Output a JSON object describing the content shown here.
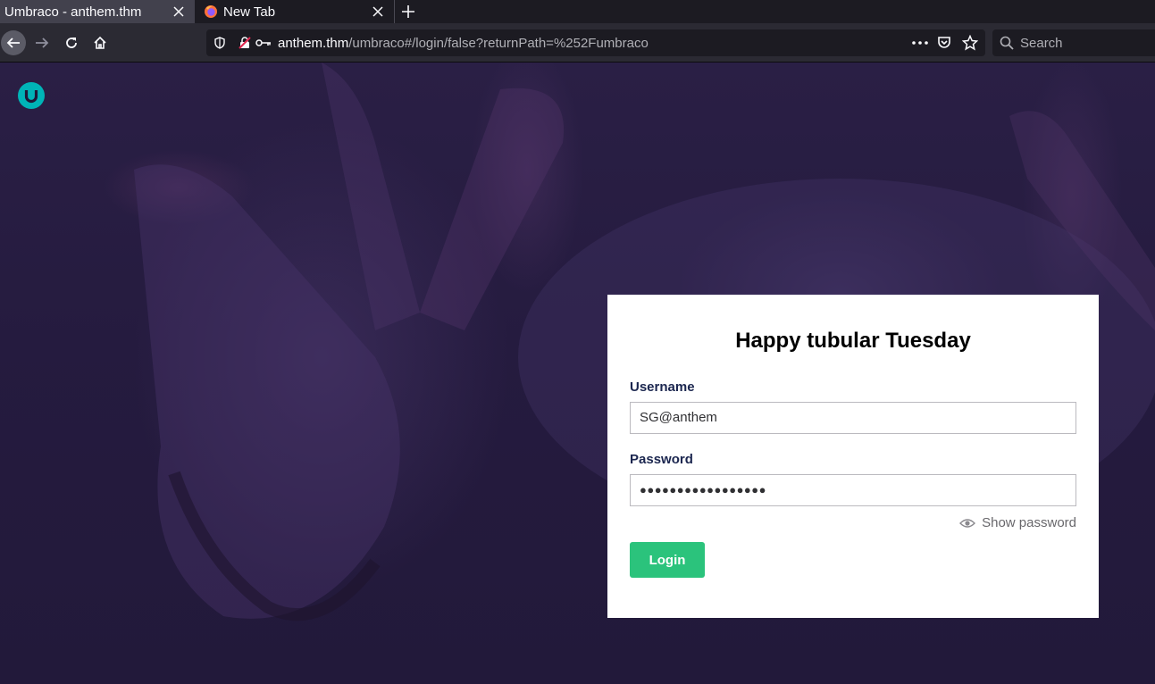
{
  "browser": {
    "tabs": [
      {
        "label": "Umbraco - anthem.thm",
        "active": true
      },
      {
        "label": "New Tab",
        "active": false
      }
    ],
    "url": {
      "host": "anthem.thm",
      "path": "/umbraco#/login/false?returnPath=%252Fumbraco"
    },
    "search_placeholder": "Search"
  },
  "login": {
    "greeting": "Happy tubular Tuesday",
    "username_label": "Username",
    "username_value": "SG@anthem",
    "password_label": "Password",
    "password_mask": "●●●●●●●●●●●●●●●●●",
    "show_password_label": "Show password",
    "login_button": "Login"
  },
  "colors": {
    "accent": "#2bc37c",
    "umbraco_logo": "#00b4b7",
    "background": "#251b3f"
  }
}
